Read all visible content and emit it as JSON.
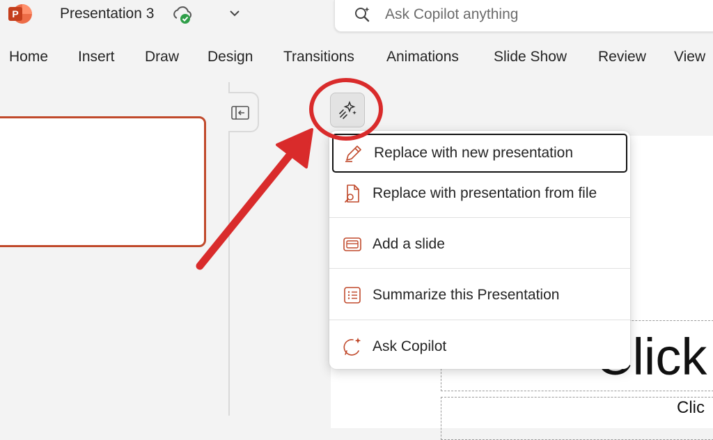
{
  "app": {
    "document_title": "Presentation 3",
    "icons": {
      "logo": "powerpoint-logo-icon",
      "sync": "cloud-saved-icon",
      "menu": "chevron-down-icon"
    }
  },
  "search": {
    "placeholder": "Ask Copilot anything",
    "icon": "copilot-search-icon"
  },
  "ribbon": {
    "tabs": [
      "Home",
      "Insert",
      "Draw",
      "Design",
      "Transitions",
      "Animations",
      "Slide Show",
      "Review",
      "View"
    ]
  },
  "copilot_menu": {
    "items": [
      {
        "label": "Replace with new presentation",
        "icon": "pencil-edit-icon"
      },
      {
        "label": "Replace with presentation from file",
        "icon": "document-search-icon"
      },
      {
        "label": "Add a slide",
        "icon": "slide-icon"
      },
      {
        "label": "Summarize this Presentation",
        "icon": "list-summary-icon"
      },
      {
        "label": "Ask Copilot",
        "icon": "chat-sparkle-icon"
      }
    ]
  },
  "slide": {
    "title_partial": "Click",
    "subtitle_partial": "Clic"
  },
  "colors": {
    "accent": "#c0492b",
    "annotation": "#d92b2b",
    "cloud_check": "#2e9e48"
  }
}
